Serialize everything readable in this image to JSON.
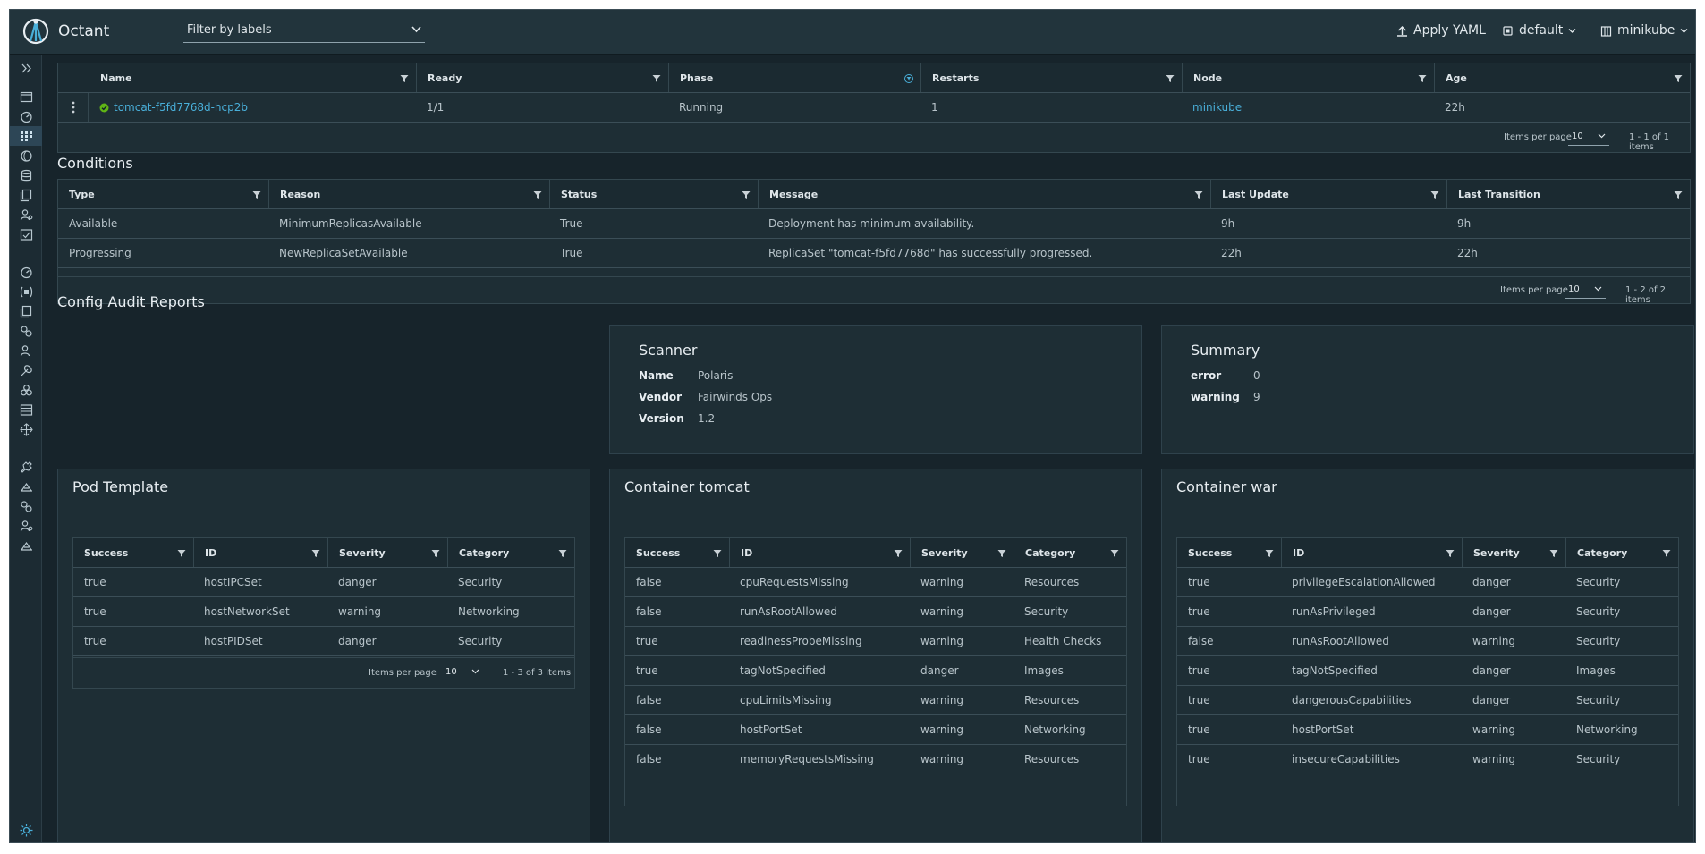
{
  "header": {
    "app_name": "Octant",
    "label_filter": "Filter by labels",
    "apply_yaml": "Apply YAML",
    "namespace": "default",
    "context": "minikube"
  },
  "pods": {
    "columns": [
      "Name",
      "Ready",
      "Phase",
      "Restarts",
      "Node",
      "Age"
    ],
    "rows": [
      {
        "name": "tomcat-f5fd7768d-hcp2b",
        "ready": "1/1",
        "phase": "Running",
        "restarts": "1",
        "node": "minikube",
        "age": "22h"
      }
    ],
    "items_per_page_label": "Items per page",
    "page_size": "10",
    "count": "1 - 1 of 1 items"
  },
  "conditions": {
    "title": "Conditions",
    "columns": [
      "Type",
      "Reason",
      "Status",
      "Message",
      "Last Update",
      "Last Transition"
    ],
    "rows": [
      [
        "Available",
        "MinimumReplicasAvailable",
        "True",
        "Deployment has minimum availability.",
        "9h",
        "9h"
      ],
      [
        "Progressing",
        "NewReplicaSetAvailable",
        "True",
        "ReplicaSet \"tomcat-f5fd7768d\" has successfully progressed.",
        "22h",
        "22h"
      ]
    ],
    "items_per_page_label": "Items per page",
    "page_size": "10",
    "count": "1 - 2 of 2 items"
  },
  "config_audit": {
    "title": "Config Audit Reports",
    "scanner": {
      "title": "Scanner",
      "name_label": "Name",
      "name": "Polaris",
      "vendor_label": "Vendor",
      "vendor": "Fairwinds Ops",
      "version_label": "Version",
      "version": "1.2"
    },
    "summary": {
      "title": "Summary",
      "error_label": "error",
      "error": "0",
      "warning_label": "warning",
      "warning": "9"
    }
  },
  "pod_template": {
    "title": "Pod Template",
    "columns": [
      "Success",
      "ID",
      "Severity",
      "Category"
    ],
    "rows": [
      [
        "true",
        "hostIPCSet",
        "danger",
        "Security"
      ],
      [
        "true",
        "hostNetworkSet",
        "warning",
        "Networking"
      ],
      [
        "true",
        "hostPIDSet",
        "danger",
        "Security"
      ]
    ],
    "items_per_page_label": "Items per page",
    "page_size": "10",
    "count": "1 - 3 of 3 items"
  },
  "container_tomcat": {
    "title": "Container tomcat",
    "columns": [
      "Success",
      "ID",
      "Severity",
      "Category"
    ],
    "rows": [
      [
        "false",
        "cpuRequestsMissing",
        "warning",
        "Resources"
      ],
      [
        "false",
        "runAsRootAllowed",
        "warning",
        "Security"
      ],
      [
        "true",
        "readinessProbeMissing",
        "warning",
        "Health Checks"
      ],
      [
        "true",
        "tagNotSpecified",
        "danger",
        "Images"
      ],
      [
        "false",
        "cpuLimitsMissing",
        "warning",
        "Resources"
      ],
      [
        "false",
        "hostPortSet",
        "warning",
        "Networking"
      ],
      [
        "false",
        "memoryRequestsMissing",
        "warning",
        "Resources"
      ]
    ]
  },
  "container_war": {
    "title": "Container war",
    "columns": [
      "Success",
      "ID",
      "Severity",
      "Category"
    ],
    "rows": [
      [
        "true",
        "privilegeEscalationAllowed",
        "danger",
        "Security"
      ],
      [
        "true",
        "runAsPrivileged",
        "danger",
        "Security"
      ],
      [
        "false",
        "runAsRootAllowed",
        "warning",
        "Security"
      ],
      [
        "true",
        "tagNotSpecified",
        "danger",
        "Images"
      ],
      [
        "true",
        "dangerousCapabilities",
        "danger",
        "Security"
      ],
      [
        "true",
        "hostPortSet",
        "warning",
        "Networking"
      ],
      [
        "true",
        "insecureCapabilities",
        "warning",
        "Security"
      ]
    ]
  },
  "icons": {
    "header": [
      "octant-logo-icon",
      "chevron-down-icon",
      "upload-icon",
      "namespace-icon",
      "cluster-icon"
    ],
    "sidebar": [
      "expand-icon",
      "applications-icon",
      "overview-icon",
      "workloads-icon",
      "discovery-icon",
      "config-storage-icon",
      "custom-resources-icon",
      "rbac-icon",
      "events-icon",
      "cluster-overview-icon",
      "namespaces-icon",
      "custom-definitions-icon",
      "port-forwards-icon",
      "rbac-cluster-icon",
      "storage-icon",
      "api-icon",
      "nodes-icon",
      "plugins-icon",
      "tools-icon",
      "helm-icon",
      "cluster-rbac-icon",
      "terminal-icon",
      "theme-icon"
    ]
  },
  "colors": {
    "background": "#17242b",
    "card": "#1e2e35",
    "header": "#22343c",
    "link": "#49afd9",
    "success": "#60b515"
  }
}
